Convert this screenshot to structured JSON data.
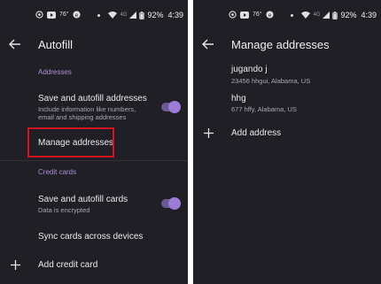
{
  "colors": {
    "background": "#211f26",
    "accent": "#a990d8",
    "toggle_knob": "#9d7cd8",
    "highlight": "#d2141c",
    "text_primary": "#ebe8ee",
    "text_secondary": "#a9a6ae"
  },
  "status_bar": {
    "temperature": "76°",
    "network_type": "4G",
    "battery": "92%",
    "time": "4:39",
    "icons": [
      "whatsapp-icon",
      "youtube-icon",
      "app-notification-icon",
      "dot-icon",
      "wifi-icon",
      "signal-icon",
      "battery-icon"
    ]
  },
  "autofill": {
    "title": "Autofill",
    "addresses_header": "Addresses",
    "save_addresses": {
      "title": "Save and autofill addresses",
      "subtitle_line1": "Include information like numbers,",
      "subtitle_line2": "email and shipping addresses",
      "toggle_on": true
    },
    "manage_addresses_label": "Manage addresses",
    "credit_cards_header": "Credit cards",
    "save_cards": {
      "title": "Save and autofill cards",
      "subtitle": "Data is encrypted",
      "toggle_on": true
    },
    "sync_cards_label": "Sync cards across devices",
    "add_credit_card_label": "Add credit card"
  },
  "manage_addresses": {
    "title": "Manage addresses",
    "addresses": [
      {
        "name": "jugando  j",
        "address": "23456 hhgui, Alabama, US"
      },
      {
        "name": "hhg",
        "address": "677 hffy, Alabama, US"
      }
    ],
    "add_address_label": "Add address"
  }
}
